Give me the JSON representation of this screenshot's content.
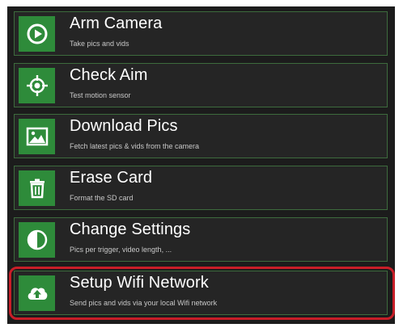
{
  "menu": {
    "items": [
      {
        "title": "Arm Camera",
        "subtitle": "Take pics and vids",
        "icon": "play-circle-icon"
      },
      {
        "title": "Check Aim",
        "subtitle": "Test motion sensor",
        "icon": "crosshair-icon"
      },
      {
        "title": "Download Pics",
        "subtitle": "Fetch latest pics & vids from the camera",
        "icon": "image-icon"
      },
      {
        "title": "Erase Card",
        "subtitle": "Format the SD card",
        "icon": "trash-icon"
      },
      {
        "title": "Change Settings",
        "subtitle": "Pics per trigger, video length, ...",
        "icon": "half-circle-icon"
      },
      {
        "title": "Setup Wifi Network",
        "subtitle": "Send pics and vids via your local Wifi network",
        "icon": "cloud-upload-icon"
      }
    ]
  },
  "colors": {
    "icon_background": "#2e8b3a",
    "item_border": "#3d6b3d",
    "panel_background": "#1c1c1c",
    "highlight": "#c81e28"
  }
}
